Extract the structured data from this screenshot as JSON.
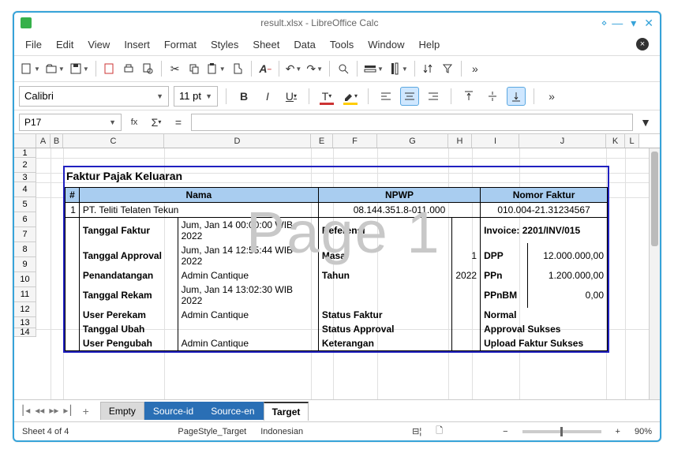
{
  "window": {
    "title": "result.xlsx - LibreOffice Calc"
  },
  "menu": [
    "File",
    "Edit",
    "View",
    "Insert",
    "Format",
    "Styles",
    "Sheet",
    "Data",
    "Tools",
    "Window",
    "Help"
  ],
  "format": {
    "font": "Calibri",
    "size": "11 pt"
  },
  "formula": {
    "cellref": "P17",
    "value": ""
  },
  "col_heads": [
    "A",
    "B",
    "C",
    "D",
    "E",
    "F",
    "G",
    "H",
    "I",
    "J",
    "K",
    "L"
  ],
  "row_nums": [
    "1",
    "2",
    "3",
    "4",
    "5",
    "6",
    "7",
    "8",
    "9",
    "10",
    "11",
    "12",
    "13",
    "14"
  ],
  "invoice": {
    "title": "Faktur Pajak Keluaran",
    "head": {
      "num": "#",
      "nama": "Nama",
      "npwp": "NPWP",
      "nomor": "Nomor Faktur"
    },
    "row1": {
      "num": "1",
      "nama": "PT. Teliti Telaten Tekun",
      "npwp": "08.144.351.8-011.000",
      "nomor": "010.004-21.31234567"
    },
    "rows": [
      {
        "l1": "Tanggal Faktur",
        "l2": "Jum, Jan 14 00:00:00 WIB 2022",
        "m1": "Referensi",
        "m2": "",
        "r1": "Invoice: 2201/INV/015",
        "r2": ""
      },
      {
        "l1": "Tanggal Approval",
        "l2": "Jum, Jan 14 12:55:44 WIB 2022",
        "m1": "Masa",
        "m2": "1",
        "r1": "DPP",
        "r2": "12.000.000,00"
      },
      {
        "l1": "Penandatangan",
        "l2": "Admin Cantique",
        "m1": "Tahun",
        "m2": "2022",
        "r1": "PPn",
        "r2": "1.200.000,00"
      },
      {
        "l1": "Tanggal Rekam",
        "l2": "Jum, Jan 14 13:02:30 WIB 2022",
        "m1": "",
        "m2": "",
        "r1": "PPnBM",
        "r2": "0,00"
      },
      {
        "l1": "User Perekam",
        "l2": "Admin Cantique",
        "m1": "Status Faktur",
        "m2": "",
        "r1": "Normal",
        "r2": ""
      },
      {
        "l1": "Tanggal Ubah",
        "l2": "",
        "m1": "Status Approval",
        "m2": "",
        "r1": "Approval Sukses",
        "r2": ""
      },
      {
        "l1": "User Pengubah",
        "l2": "Admin Cantique",
        "m1": "Keterangan",
        "m2": "",
        "r1": "Upload Faktur Sukses",
        "r2": ""
      }
    ],
    "watermark": "Page 1"
  },
  "tabs": [
    "Empty",
    "Source-id",
    "Source-en",
    "Target"
  ],
  "status": {
    "sheet": "Sheet 4 of 4",
    "style": "PageStyle_Target",
    "lang": "Indonesian",
    "zoom": "90%"
  }
}
